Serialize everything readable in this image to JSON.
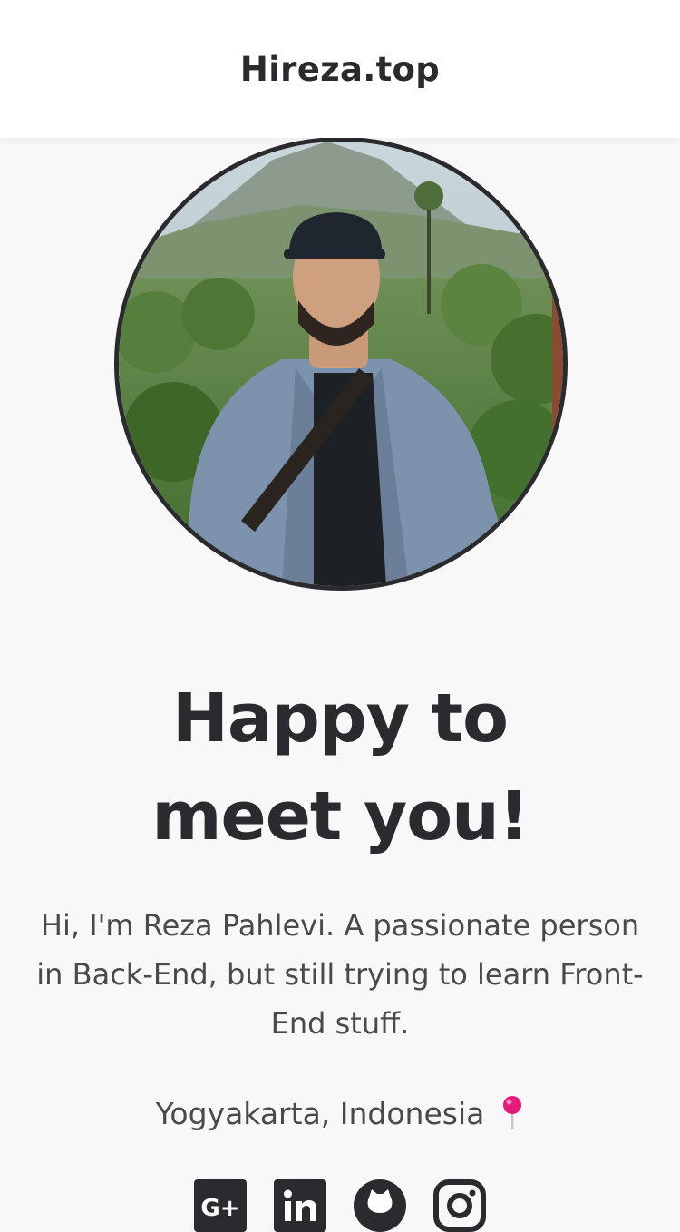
{
  "header": {
    "brand": "Hireza.top"
  },
  "profile": {
    "photo_icon": "profile-photo",
    "headline_line1": "Happy to",
    "headline_line2": "meet you!",
    "bio": "Hi, I'm Reza Pahlevi. A passionate person in Back-End, but still trying to learn Front-End stuff.",
    "location": "Yogyakarta, Indonesia",
    "location_icon": "map-pin-icon"
  },
  "socials": [
    {
      "name": "google-plus-icon"
    },
    {
      "name": "linkedin-icon"
    },
    {
      "name": "github-icon"
    },
    {
      "name": "instagram-icon"
    }
  ],
  "colors": {
    "text": "#2b2b2f",
    "muted": "#4a4a4e",
    "background": "#f8f8f8",
    "header": "#ffffff",
    "pin": "#e6197a"
  }
}
